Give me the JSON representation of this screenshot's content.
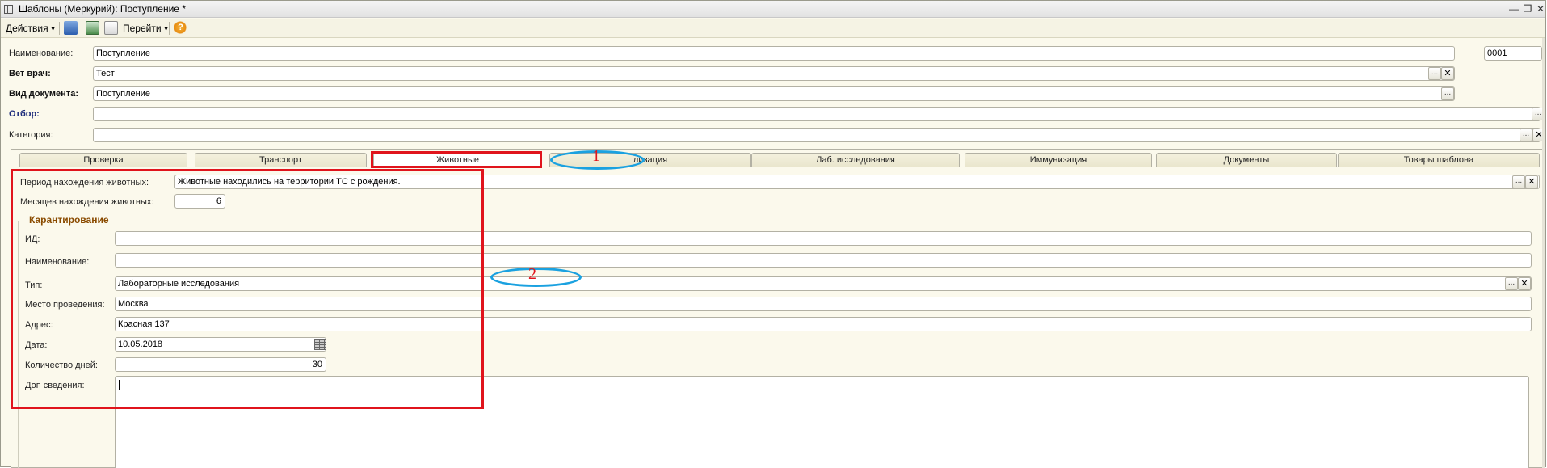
{
  "window": {
    "title": "Шаблоны (Меркурий): Поступление *"
  },
  "toolbar": {
    "actions_label": "Действия",
    "goto_label": "Перейти",
    "help_glyph": "?"
  },
  "header": {
    "name_label": "Наименование:",
    "name_value": "Поступление",
    "code_value": "0001",
    "vet_label": "Вет врач:",
    "vet_value": "Тест",
    "doctype_label": "Вид документа:",
    "doctype_value": "Поступление",
    "filter_label": "Отбор:",
    "filter_value": "",
    "category_label": "Категория:",
    "category_value": ""
  },
  "tabs": [
    {
      "label": "Проверка"
    },
    {
      "label": "Транспорт"
    },
    {
      "label": "Животные"
    },
    {
      "label": "лизация"
    },
    {
      "label": "Лаб. исследования"
    },
    {
      "label": "Иммунизация"
    },
    {
      "label": "Документы"
    },
    {
      "label": "Товары шаблона"
    }
  ],
  "animals": {
    "period_label": "Период нахождения животных:",
    "period_value": "Животные находились на территории ТС с рождения.",
    "months_label": "Месяцев нахождения животных:",
    "months_value": "6"
  },
  "quarantine": {
    "group_title": "Карантирование",
    "id_label": "ИД:",
    "id_value": "",
    "name_label": "Наименование:",
    "name_value": "",
    "type_label": "Тип:",
    "type_value": "Лабораторные исследования",
    "place_label": "Место проведения:",
    "place_value": "Москва",
    "address_label": "Адрес:",
    "address_value": "Красная 137",
    "date_label": "Дата:",
    "date_value": "10.05.2018",
    "days_label": "Количество дней:",
    "days_value": "30",
    "extra_label": "Доп сведения:",
    "extra_value": ""
  },
  "annotations": {
    "mark1": "1",
    "mark2": "2",
    "red_color": "#e0141c",
    "blue_color": "#1aa1e0"
  }
}
